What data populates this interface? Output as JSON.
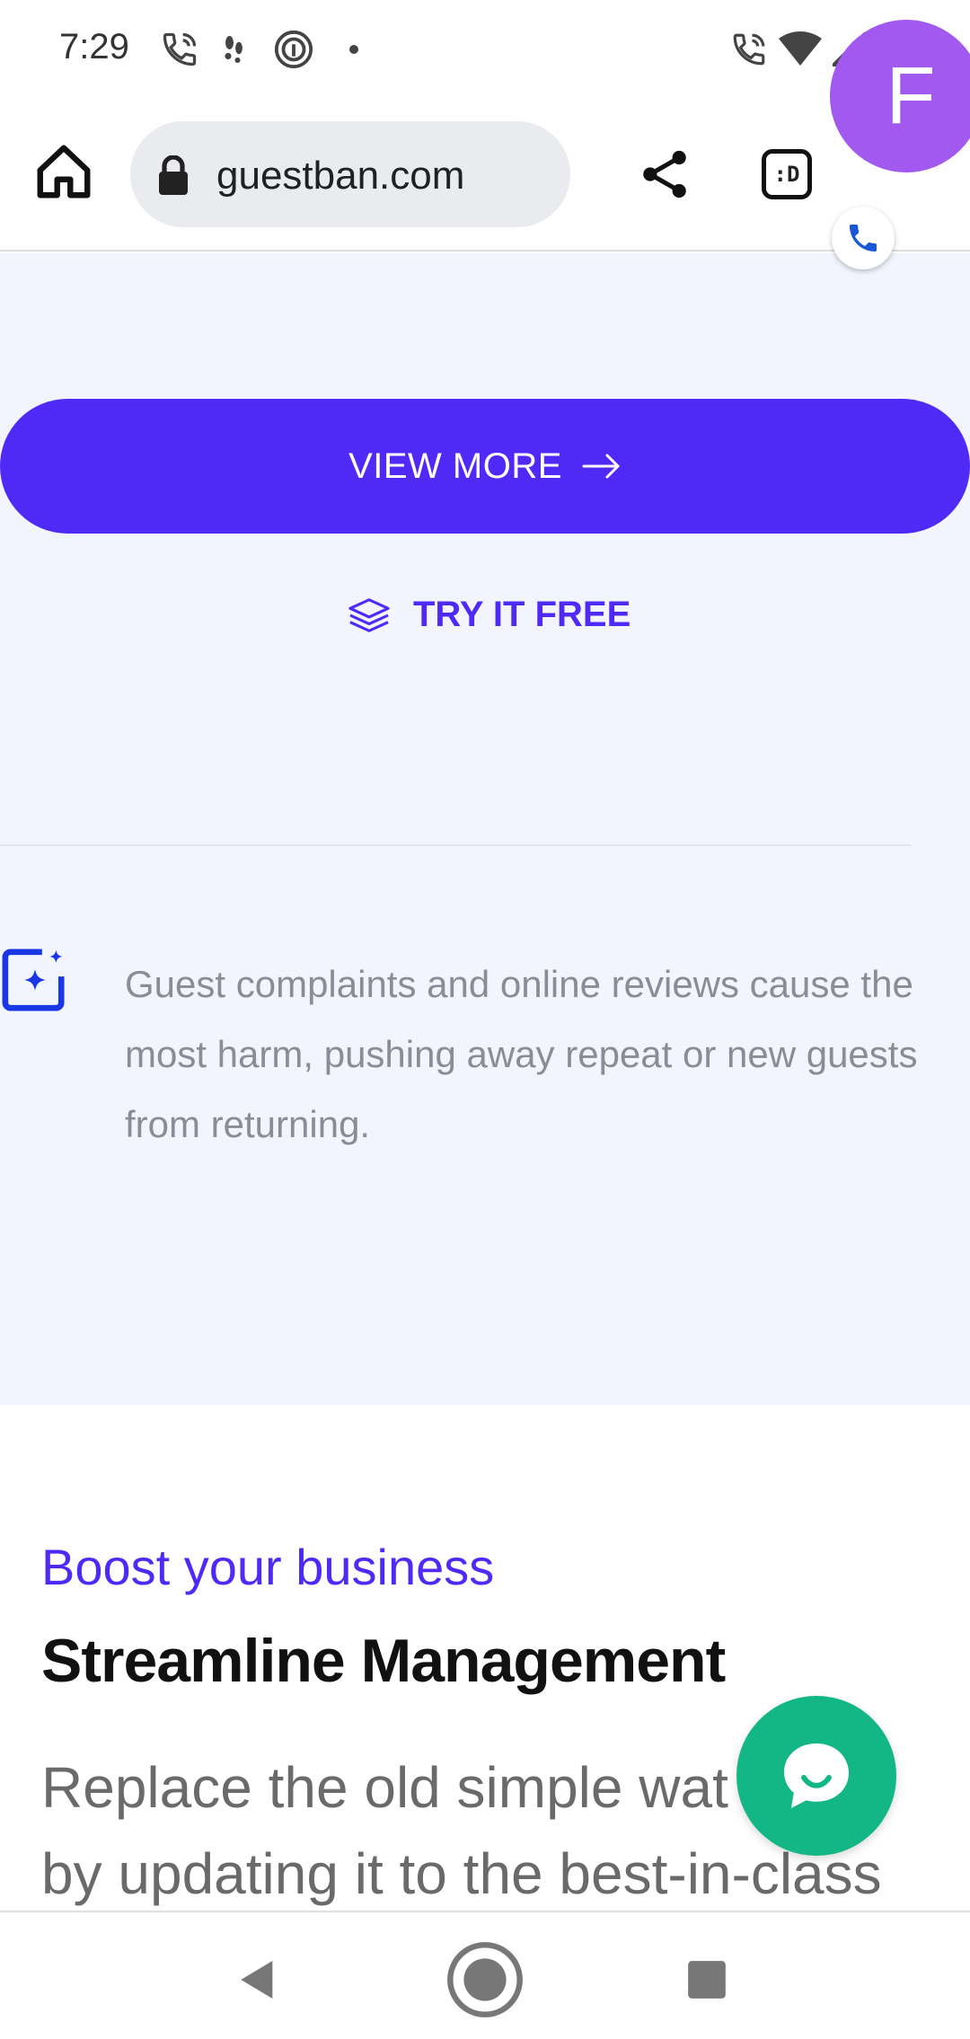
{
  "status_bar": {
    "time": "7:29",
    "icons_left": [
      "wifi-call-icon",
      "walking-icon",
      "fingerprint-icon",
      "dot-icon"
    ],
    "icons_right": [
      "wifi-call-icon",
      "wifi-icon",
      "signal-icon",
      "battery-icon"
    ]
  },
  "browser": {
    "url": "guestban.com",
    "tabs_label": ":D",
    "profile_initial": "F",
    "icons": [
      "home-icon",
      "lock-icon",
      "share-icon",
      "tabs-icon",
      "phone-icon"
    ]
  },
  "hero": {
    "cut_text": "",
    "view_more_label": "VIEW MORE",
    "try_free_label": "TRY IT FREE",
    "feature_text": "Guest complaints and online reviews cause the most harm, pushing away repeat or new guests from returning."
  },
  "section": {
    "eyebrow": "Boost your business",
    "title": "Streamline Management",
    "body_line1": "Replace the old simple wat",
    "body_line2": "by updating it to the best-in-class"
  },
  "colors": {
    "accent": "#4f2af6",
    "hero_bg": "#f2f5fd",
    "avatar": "#a259ef",
    "chat": "#13b786"
  },
  "nav": {
    "icons": [
      "back-icon",
      "home-circle-icon",
      "recents-icon"
    ]
  }
}
